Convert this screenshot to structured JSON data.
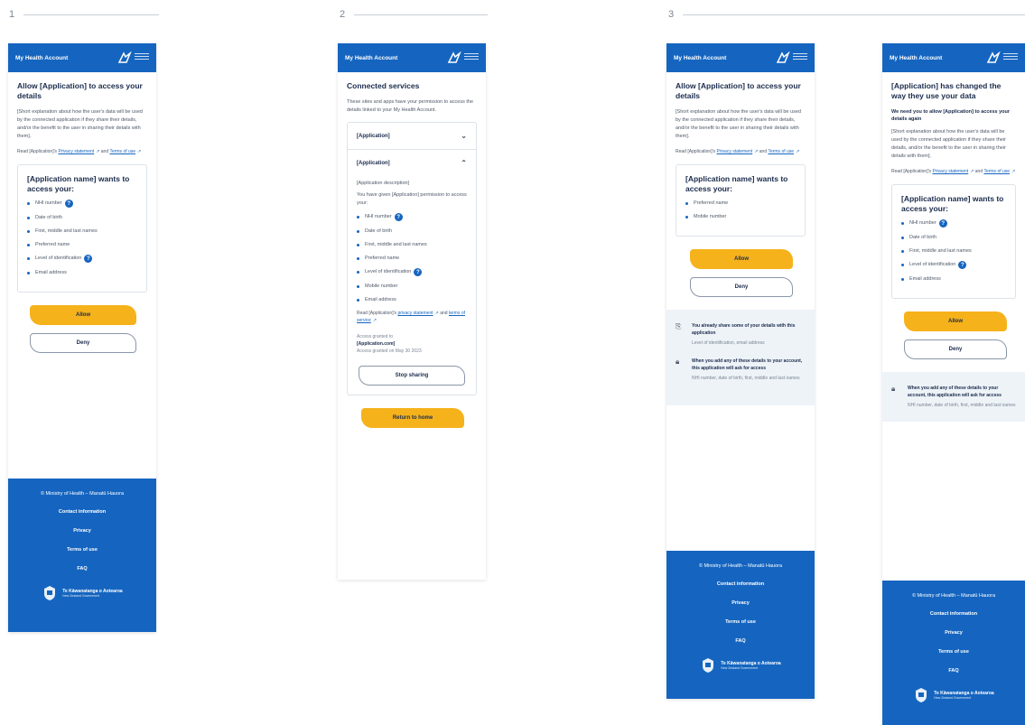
{
  "sections": [
    {
      "number": "1"
    },
    {
      "number": "2"
    },
    {
      "number": "3"
    }
  ],
  "header": {
    "title": "My Health Account"
  },
  "screen1": {
    "title": "Allow [Application] to access your details",
    "explanation": "[Short explanation about how the user's data will be used by the connected application if they share their details, and/or the benefit to the user in sharing their details with them].",
    "links_prefix": "Read [Application]'s",
    "privacy_link": "Privacy statement",
    "links_and": "and",
    "terms_link": "Terms of use",
    "card_title": "[Application name] wants to access your:",
    "items": [
      "NHI number",
      "Date of birth",
      "First, middle and last names",
      "Preferred name",
      "Level of identification",
      "Email address"
    ],
    "allow": "Allow",
    "deny": "Deny"
  },
  "screen2": {
    "title": "Connected services",
    "intro": "These sites and apps have your permission to access the details linked to your My Health Account.",
    "app_collapsed": "[Application]",
    "app_expanded": "[Application]",
    "description": "[Application description]",
    "permission_text": "You have given [Application] permission to access your:",
    "items": [
      "NHI number",
      "Date of birth",
      "First, middle and last names",
      "Preferred name",
      "Level of identification",
      "Mobile number",
      "Email address"
    ],
    "links_prefix": "Read [Application]'s",
    "privacy_link": "privacy statement",
    "links_and": "and",
    "terms_link": "terms of service",
    "access_granted_label": "Access granted to",
    "access_granted_to": "[Application.com]",
    "access_granted_date": "Access granted on May 30 2023",
    "stop_sharing": "Stop sharing",
    "return_home": "Return to home"
  },
  "screen3a": {
    "title": "Allow [Application] to access your details",
    "explanation": "[Short explanation about how the user's data will be used by the connected application if they share their details, and/or the benefit to the user in sharing their details with them].",
    "links_prefix": "Read [Application]'s",
    "privacy_link": "Privacy statement",
    "links_and": "and",
    "terms_link": "Terms of use",
    "card_title": "[Application name] wants to access your:",
    "items": [
      "Preferred name",
      "Mobile number"
    ],
    "allow": "Allow",
    "deny": "Deny",
    "info1_title": "You already share some of your details with this application",
    "info1_sub": "Level of identification, email address",
    "info2_title": "When you add any of these details to your account, this application will ask for access",
    "info2_sub": "NHI number, date of birth, first, middle and last names"
  },
  "screen3b": {
    "title": "[Application] has changed the way they use your data",
    "subtitle": "We need you to allow [Application] to access your details again",
    "explanation": "[Short explanation about how the user's data will be used by the connected application if they share their details, and/or the benefit to the user in sharing their details with them].",
    "links_prefix": "Read [Application]'s",
    "privacy_link": "Privacy statement",
    "links_and": "and",
    "terms_link": "Terms of use",
    "card_title": "[Application name] wants to access your:",
    "items": [
      "NHI number",
      "Date of birth",
      "First, middle and last names",
      "Level of identification",
      "Email address"
    ],
    "allow": "Allow",
    "deny": "Deny",
    "info_title": "When you add any of these details to your account, this application will ask for access",
    "info_sub": "NHI number, date of birth, first, middle and last names"
  },
  "footer": {
    "copyright": "© Ministry of Health – Manatū Hauora",
    "links": [
      "Contact information",
      "Privacy",
      "Terms of use",
      "FAQ"
    ],
    "gov_name": "Te Kāwanatanga o Aotearoa",
    "gov_sub": "New Zealand Government"
  },
  "colors": {
    "brand_blue": "#1565c0",
    "accent_yellow": "#f5b21b",
    "text_dark": "#1a2b4c"
  }
}
